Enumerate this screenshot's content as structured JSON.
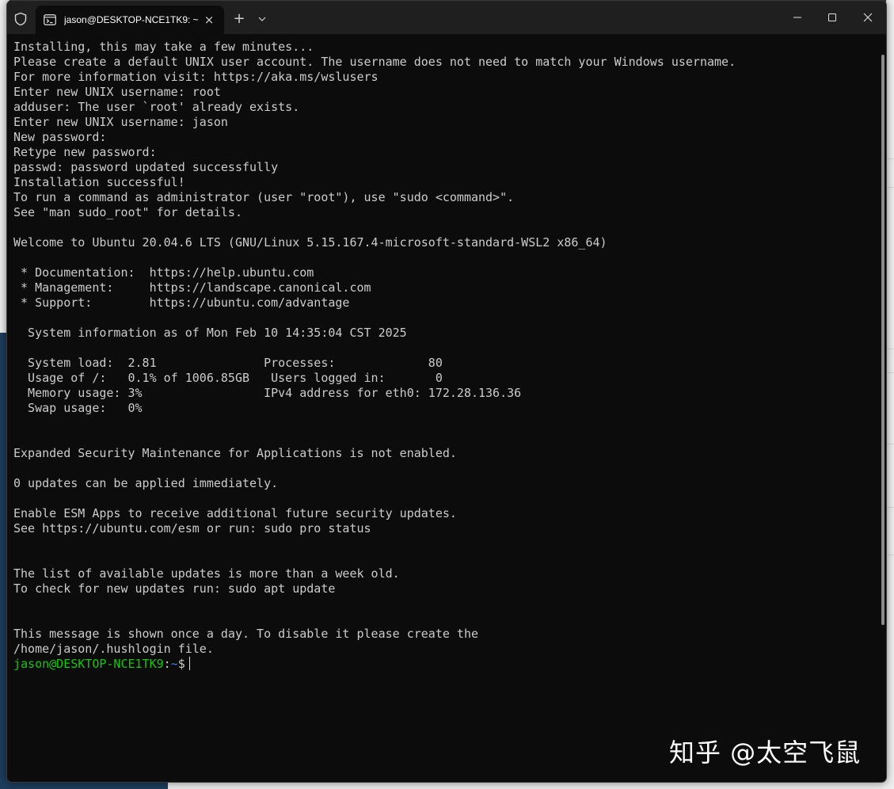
{
  "window": {
    "tab_title": "jason@DESKTOP-NCE1TK9: ~",
    "tab_close": "×",
    "new_tab": "+",
    "dropdown": "⌄"
  },
  "terminal": {
    "lines": [
      "Installing, this may take a few minutes...",
      "Please create a default UNIX user account. The username does not need to match your Windows username.",
      "For more information visit: https://aka.ms/wslusers",
      "Enter new UNIX username: root",
      "adduser: The user `root' already exists.",
      "Enter new UNIX username: jason",
      "New password:",
      "Retype new password:",
      "passwd: password updated successfully",
      "Installation successful!",
      "To run a command as administrator (user \"root\"), use \"sudo <command>\".",
      "See \"man sudo_root\" for details.",
      "",
      "Welcome to Ubuntu 20.04.6 LTS (GNU/Linux 5.15.167.4-microsoft-standard-WSL2 x86_64)",
      "",
      " * Documentation:  https://help.ubuntu.com",
      " * Management:     https://landscape.canonical.com",
      " * Support:        https://ubuntu.com/advantage",
      "",
      "  System information as of Mon Feb 10 14:35:04 CST 2025",
      "",
      "  System load:  2.81               Processes:             80",
      "  Usage of /:   0.1% of 1006.85GB   Users logged in:       0",
      "  Memory usage: 3%                 IPv4 address for eth0: 172.28.136.36",
      "  Swap usage:   0%",
      "",
      "",
      "Expanded Security Maintenance for Applications is not enabled.",
      "",
      "0 updates can be applied immediately.",
      "",
      "Enable ESM Apps to receive additional future security updates.",
      "See https://ubuntu.com/esm or run: sudo pro status",
      "",
      "",
      "The list of available updates is more than a week old.",
      "To check for new updates run: sudo apt update",
      "",
      "",
      "This message is shown once a day. To disable it please create the",
      "/home/jason/.hushlogin file."
    ],
    "prompt": {
      "user_host": "jason@DESKTOP-NCE1TK9",
      "separator": ":",
      "path": "~",
      "symbol": "$"
    }
  },
  "watermark": "知乎 @太空飞鼠",
  "colors": {
    "terminal_bg": "#0c0c0c",
    "text": "#cccccc",
    "prompt_user": "#16c60c",
    "prompt_path": "#3b78ff",
    "titlebar": "#1f1f1f"
  },
  "icons": {
    "shield": "shield-icon",
    "tab": "terminal-tab-icon",
    "minimize": "minimize-icon",
    "maximize": "maximize-icon",
    "close": "close-icon"
  }
}
